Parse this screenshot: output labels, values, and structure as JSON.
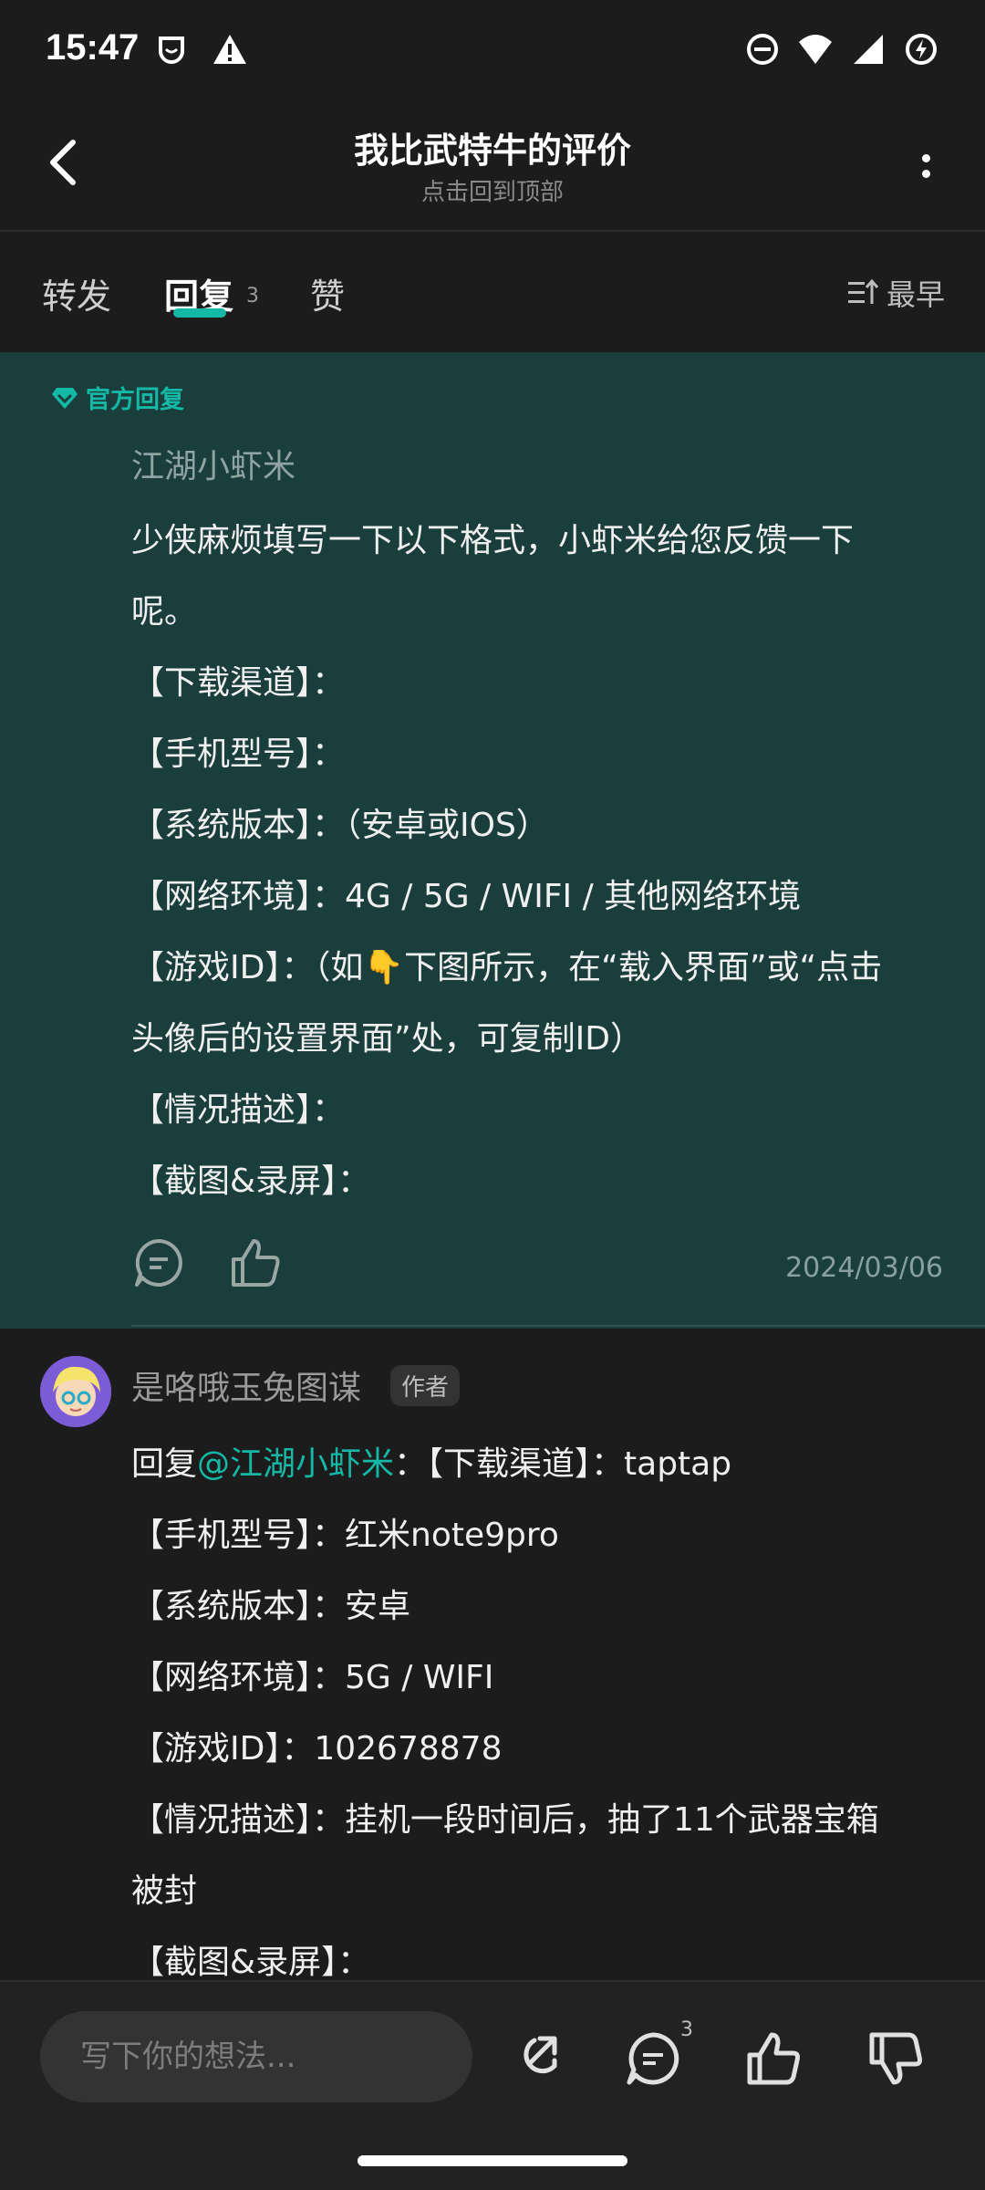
{
  "status_bar": {
    "time": "15:47"
  },
  "header": {
    "title": "我比武特牛的评价",
    "subtitle": "点击回到顶部"
  },
  "tabs": {
    "forward": "转发",
    "reply": "回复",
    "reply_count": "3",
    "like": "赞",
    "sort": "最早"
  },
  "official_reply": {
    "badge": "官方回复",
    "author": "江湖小虾米",
    "lines": [
      "少侠麻烦填写一下以下格式，小虾米给您反馈一下",
      "呢。",
      "【下载渠道】：",
      "【手机型号】：",
      "【系统版本】：（安卓或IOS）",
      "【网络环境】：4G / 5G / WIFI / 其他网络环境",
      "【游戏ID】：（如👇下图所示，在“载入界面”或“点击",
      "头像后的设置界面”处，可复制ID）",
      "【情况描述】：",
      "【截图&录屏】："
    ],
    "date": "2024/03/06"
  },
  "author_reply": {
    "author": "是咯哦玉兔图谋",
    "author_tag": "作者",
    "reply_prefix": "回复",
    "mention": "@江湖小虾米",
    "first_line_rest": "：【下载渠道】：taptap",
    "lines": [
      "【手机型号】：红米note9pro",
      "【系统版本】：安卓",
      "【网络环境】：5G / WIFI",
      "【游戏ID】：102678878",
      "【情况描述】：挂机一段时间后，抽了11个武器宝箱",
      "被封",
      "【截图&录屏】："
    ]
  },
  "bottom_bar": {
    "input_placeholder": "写下你的想法...",
    "comment_count": "3"
  },
  "colors": {
    "accent": "#14b8a6",
    "official_bg": "#193e3b",
    "page_bg": "#1c1c1c"
  }
}
